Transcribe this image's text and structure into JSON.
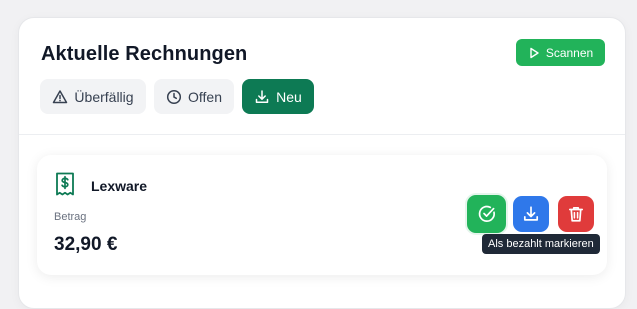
{
  "header": {
    "title": "Aktuelle Rechnungen",
    "scan_label": "Scannen"
  },
  "filters": [
    {
      "label": "Überfällig",
      "icon": "warning-triangle-icon",
      "active": false
    },
    {
      "label": "Offen",
      "icon": "clock-icon",
      "active": false
    },
    {
      "label": "Neu",
      "icon": "download-icon",
      "active": true
    }
  ],
  "invoice": {
    "vendor": "Lexware",
    "vendor_icon": "receipt-dollar-icon",
    "amount_label": "Betrag",
    "amount": "32,90 €"
  },
  "actions": {
    "mark_paid_icon": "check-circle-icon",
    "download_icon": "download-icon",
    "delete_icon": "trash-icon"
  },
  "tooltip": "Als bezahlt markieren",
  "colors": {
    "green": "#22b35a",
    "dark_green": "#0d7a54",
    "blue": "#2f78ea",
    "red": "#e03b3b"
  }
}
